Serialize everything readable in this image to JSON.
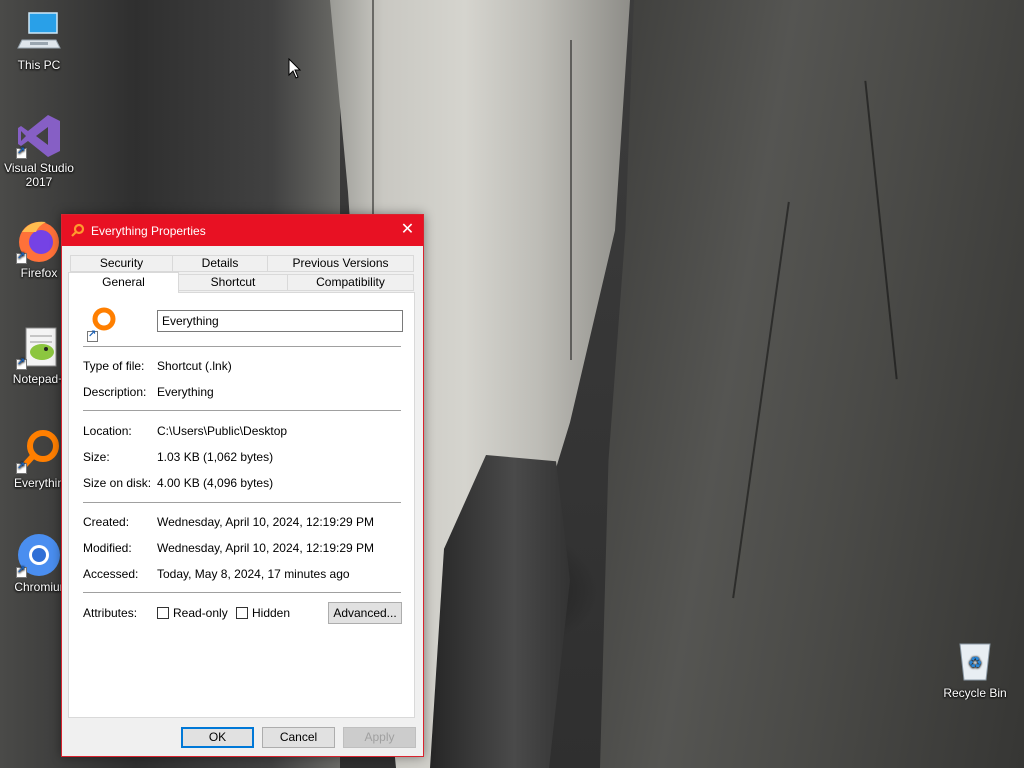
{
  "desktop": {
    "icons": [
      {
        "label": "This PC",
        "icon": "this-pc-icon"
      },
      {
        "label": "Visual Studio 2017",
        "line1": "Visual Studio",
        "line2": "2017",
        "icon": "visual-studio-icon"
      },
      {
        "label": "Firefox",
        "icon": "firefox-icon"
      },
      {
        "label": "Notepad++",
        "short": "Notepad+",
        "icon": "notepad-plus-plus-icon"
      },
      {
        "label": "Everything",
        "short": "Everythin",
        "icon": "everything-icon"
      },
      {
        "label": "Chromium",
        "short": "Chromiur",
        "icon": "chromium-icon"
      },
      {
        "label": "Recycle Bin",
        "icon": "recycle-bin-icon"
      }
    ]
  },
  "dialog": {
    "title": "Everything Properties",
    "close_glyph": "✕",
    "tabs": {
      "security": "Security",
      "details": "Details",
      "previous_versions": "Previous Versions",
      "general": "General",
      "shortcut": "Shortcut",
      "compatibility": "Compatibility"
    },
    "general": {
      "name_value": "Everything",
      "type_label": "Type of file:",
      "type_value": "Shortcut (.lnk)",
      "description_label": "Description:",
      "description_value": "Everything",
      "location_label": "Location:",
      "location_value": "C:\\Users\\Public\\Desktop",
      "size_label": "Size:",
      "size_value": "1.03 KB (1,062 bytes)",
      "size_on_disk_label": "Size on disk:",
      "size_on_disk_value": "4.00 KB (4,096 bytes)",
      "created_label": "Created:",
      "created_value": "Wednesday, April 10, 2024, 12:19:29 PM",
      "modified_label": "Modified:",
      "modified_value": "Wednesday, April 10, 2024, 12:19:29 PM",
      "accessed_label": "Accessed:",
      "accessed_value": "Today, May 8, 2024, 17 minutes ago",
      "attributes_label": "Attributes:",
      "readonly_label": "Read-only",
      "readonly_checked": false,
      "hidden_label": "Hidden",
      "hidden_checked": false,
      "advanced_label": "Advanced..."
    },
    "buttons": {
      "ok": "OK",
      "cancel": "Cancel",
      "apply": "Apply"
    },
    "colors": {
      "titlebar": "#e81123",
      "accent": "#0078d7"
    }
  }
}
